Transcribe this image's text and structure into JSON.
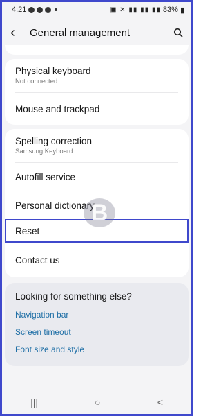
{
  "status_bar": {
    "time": "4:21",
    "battery": "83%"
  },
  "app_bar": {
    "title": "General management",
    "back_icon": "back-arrow-icon",
    "search_icon": "search-icon"
  },
  "top_partial_row": "",
  "group1": [
    {
      "label": "Physical keyboard",
      "sub": "Not connected"
    },
    {
      "label": "Mouse and trackpad",
      "sub": ""
    }
  ],
  "group2": [
    {
      "label": "Spelling correction",
      "sub": "Samsung Keyboard"
    },
    {
      "label": "Autofill service",
      "sub": ""
    },
    {
      "label": "Personal dictionary",
      "sub": ""
    }
  ],
  "reset_label": "Reset",
  "contact_label": "Contact us",
  "suggestions": {
    "heading": "Looking for something else?",
    "links": [
      "Navigation bar",
      "Screen timeout",
      "Font size and style"
    ]
  },
  "nav": {
    "recents": "|||",
    "home": "○",
    "back": "<"
  },
  "watermark_letter": "B"
}
